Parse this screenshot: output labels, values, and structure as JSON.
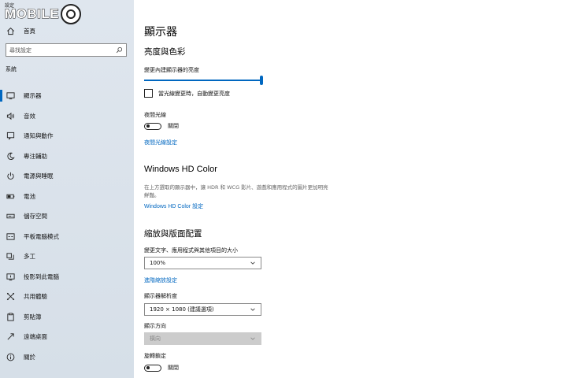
{
  "sidebar": {
    "tiny_title": "設定",
    "logo_text": "MOBILE",
    "home": {
      "label": "首頁",
      "icon": "home-icon"
    },
    "search": {
      "placeholder": "尋找設定",
      "icon": "search-icon"
    },
    "section_label": "系統",
    "items": [
      {
        "label": "顯示器",
        "icon": "monitor-icon",
        "active": true
      },
      {
        "label": "音效",
        "icon": "speaker-icon"
      },
      {
        "label": "通知與動作",
        "icon": "notification-icon"
      },
      {
        "label": "專注輔助",
        "icon": "moon-icon"
      },
      {
        "label": "電源與睡眠",
        "icon": "power-icon"
      },
      {
        "label": "電池",
        "icon": "battery-icon"
      },
      {
        "label": "儲存空間",
        "icon": "storage-icon"
      },
      {
        "label": "平板電腦模式",
        "icon": "tablet-icon"
      },
      {
        "label": "多工",
        "icon": "multitasking-icon"
      },
      {
        "label": "投影到此電腦",
        "icon": "project-icon"
      },
      {
        "label": "共用體驗",
        "icon": "shared-experience-icon"
      },
      {
        "label": "剪貼簿",
        "icon": "clipboard-icon"
      },
      {
        "label": "遠端桌面",
        "icon": "remote-desktop-icon"
      },
      {
        "label": "關於",
        "icon": "info-icon"
      }
    ]
  },
  "main": {
    "title": "顯示器",
    "brightness": {
      "heading": "亮度與色彩",
      "slider_label": "變更內建顯示器的亮度",
      "brightness_value": 1.0,
      "auto_checkbox_label": "當光線變更時，自動變更亮度",
      "auto_checked": false,
      "night_light_label": "夜間光線",
      "night_light_state": "關閉",
      "night_light_settings_link": "夜間光線設定"
    },
    "hdr": {
      "heading": "Windows HD Color",
      "description": "在上方選取的顯示器中，讓 HDR 和 WCG 影片、遊戲和應用程式的圖片更加明亮鮮豔。",
      "settings_link": "Windows HD Color 設定"
    },
    "scale_layout": {
      "heading": "縮放與版面配置",
      "scale_label": "變更文字、應用程式與其他項目的大小",
      "scale_value": "100%",
      "advanced_scaling_link": "進階縮放設定",
      "resolution_label": "顯示器解析度",
      "resolution_value": "1920 × 1080 (建議選項)",
      "orientation_label": "顯示方向",
      "orientation_value": "橫向",
      "rotation_lock_label": "旋轉鎖定",
      "rotation_lock_state": "關閉"
    }
  }
}
